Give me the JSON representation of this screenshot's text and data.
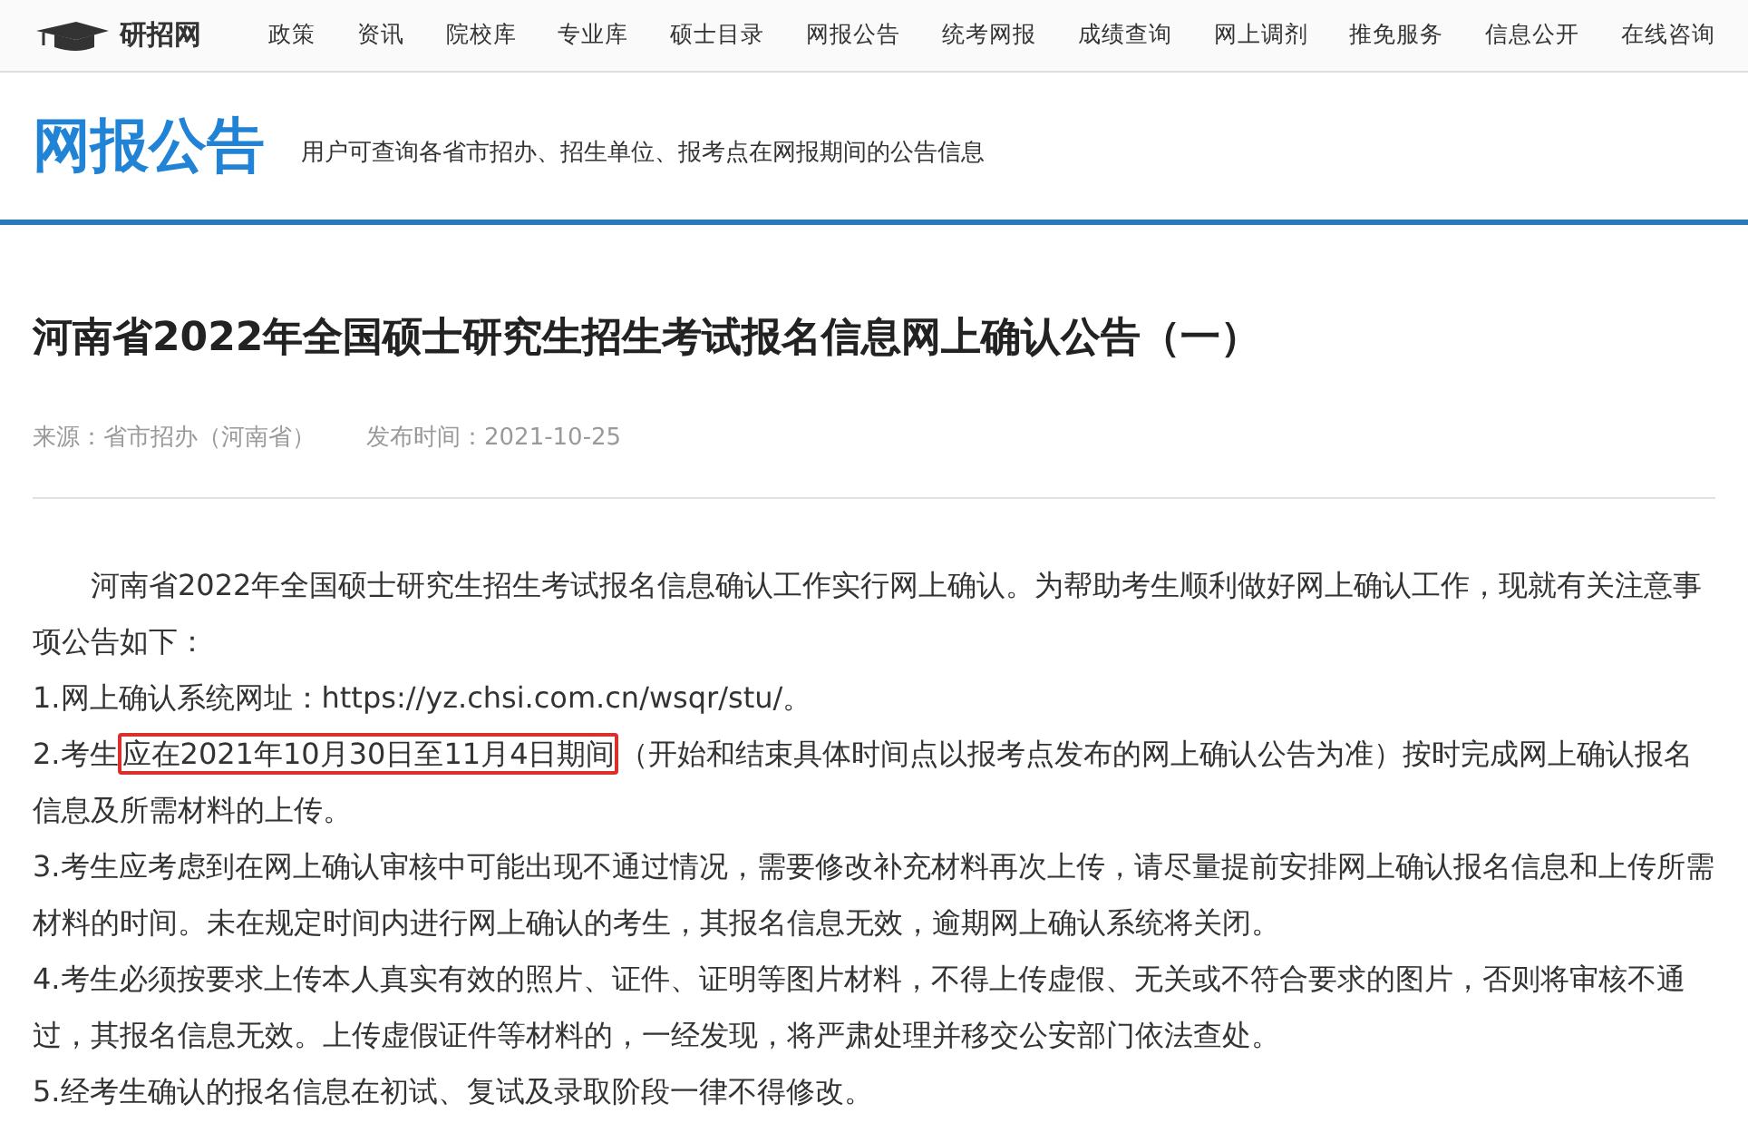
{
  "nav": {
    "logo": "研招网",
    "items": [
      "政策",
      "资讯",
      "院校库",
      "专业库",
      "硕士目录",
      "网报公告",
      "统考网报",
      "成绩查询",
      "网上调剂",
      "推免服务",
      "信息公开",
      "在线咨询"
    ]
  },
  "header": {
    "title": "网报公告",
    "subtitle": "用户可查询各省市招办、招生单位、报考点在网报期间的公告信息"
  },
  "article": {
    "title": "河南省2022年全国硕士研究生招生考试报名信息网上确认公告（一）",
    "source": "来源：省市招办（河南省）",
    "date": "发布时间：2021-10-25",
    "paragraphs": [
      {
        "indent": true,
        "text": "河南省2022年全国硕士研究生招生考试报名信息确认工作实行网上确认。为帮助考生顺利做好网上确认工作，现就有关注意事项公告如下："
      },
      {
        "indent": false,
        "text": "1.网上确认系统网址：https://yz.chsi.com.cn/wsqr/stu/。"
      },
      {
        "indent": false,
        "text": "2.考生",
        "highlight": "应在2021年10月30日至11月4日期间",
        "after": "（开始和结束具体时间点以报考点发布的网上确认公告为准）按时完成网上确认报名信息及所需材料的上传。"
      },
      {
        "indent": false,
        "text": "3.考生应考虑到在网上确认审核中可能出现不通过情况，需要修改补充材料再次上传，请尽量提前安排网上确认报名信息和上传所需材料的时间。未在规定时间内进行网上确认的考生，其报名信息无效，逾期网上确认系统将关闭。"
      },
      {
        "indent": false,
        "text": "4.考生必须按要求上传本人真实有效的照片、证件、证明等图片材料，不得上传虚假、无关或不符合要求的图片，否则将审核不通过，其报名信息无效。上传虚假证件等材料的，一经发现，将严肃处理并移交公安部门依法查处。"
      },
      {
        "indent": false,
        "text": "5.经考生确认的报名信息在初试、复试及录取阶段一律不得修改。"
      }
    ]
  }
}
